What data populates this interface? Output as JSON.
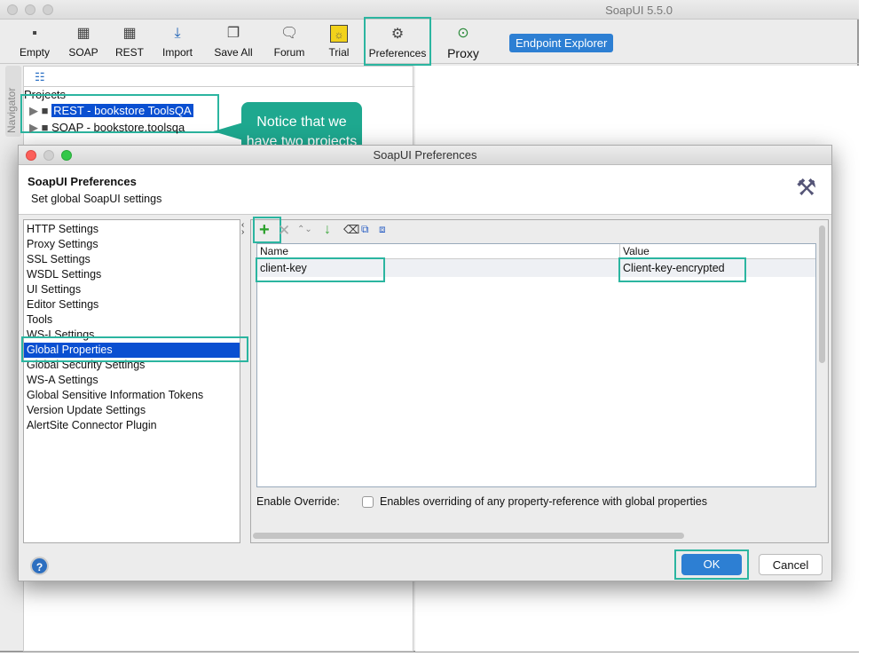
{
  "app": {
    "title": "SoapUI 5.5.0"
  },
  "toolbar": {
    "items": [
      {
        "label": "Empty",
        "icon": "empty-project-icon"
      },
      {
        "label": "SOAP",
        "icon": "soap-icon"
      },
      {
        "label": "REST",
        "icon": "rest-icon"
      },
      {
        "label": "Import",
        "icon": "import-icon"
      },
      {
        "label": "Save All",
        "icon": "save-all-icon"
      },
      {
        "label": "Forum",
        "icon": "forum-icon"
      },
      {
        "label": "Trial",
        "icon": "trial-icon"
      },
      {
        "label": "Preferences",
        "icon": "gear-icon"
      },
      {
        "label": "Proxy",
        "icon": "proxy-icon"
      }
    ],
    "endpoint_explorer": "Endpoint Explorer"
  },
  "navigator": {
    "label": "Navigator",
    "projects_label": "Projects",
    "projects": [
      "REST - bookstore ToolsQA",
      "SOAP - bookstore.toolsqa"
    ]
  },
  "callout": "Notice that we have two projects",
  "dialog": {
    "title": "SoapUI Preferences",
    "heading": "SoapUI Preferences",
    "subheading": "Set global SoapUI settings",
    "categories": [
      "HTTP Settings",
      "Proxy Settings",
      "SSL Settings",
      "WSDL Settings",
      "UI Settings",
      "Editor Settings",
      "Tools",
      "WS-I Settings",
      "Global Properties",
      "Global Security Settings",
      "WS-A Settings",
      "Global Sensitive Information Tokens",
      "Version Update Settings",
      "AlertSite Connector Plugin"
    ],
    "selected_category": "Global Properties",
    "table": {
      "columns": [
        "Name",
        "Value"
      ],
      "rows": [
        {
          "name": "client-key",
          "value": "Client-key-encrypted"
        }
      ]
    },
    "enable_override_label": "Enable Override:",
    "enable_override_text": "Enables overriding of any property-reference with global properties",
    "enable_override_checked": false,
    "ok": "OK",
    "cancel": "Cancel",
    "help": "?"
  },
  "colors": {
    "highlight": "#2bb5a0",
    "selection": "#0a4fd1",
    "button_primary": "#2d7fd3"
  }
}
